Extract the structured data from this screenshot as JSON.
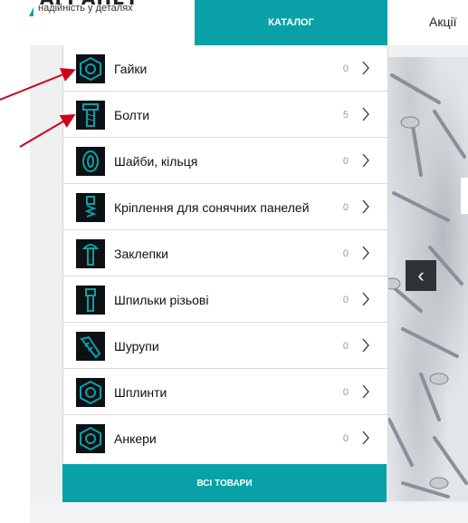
{
  "header": {
    "logo_text": "АГРАНЕТ",
    "tagline": "надійність у деталях",
    "catalog_label": "КАТАЛОГ",
    "promo_label": "Акції"
  },
  "menu": {
    "items": [
      {
        "label": "Гайки",
        "count": "0",
        "icon": "nut-icon"
      },
      {
        "label": "Болти",
        "count": "5",
        "icon": "bolt-icon"
      },
      {
        "label": "Шайби, кільця",
        "count": "0",
        "icon": "washer-icon"
      },
      {
        "label": "Кріплення для сонячних панелей",
        "count": "0",
        "icon": "solar-mount-icon"
      },
      {
        "label": "Заклепки",
        "count": "0",
        "icon": "rivet-icon"
      },
      {
        "label": "Шпильки різьові",
        "count": "0",
        "icon": "threaded-rod-icon"
      },
      {
        "label": "Шурупи",
        "count": "0",
        "icon": "screw-icon"
      },
      {
        "label": "Шплинти",
        "count": "0",
        "icon": "cotter-pin-icon"
      },
      {
        "label": "Анкери",
        "count": "0",
        "icon": "anchor-icon"
      }
    ],
    "all_products_label": "ВСІ ТОВАРИ"
  },
  "slider": {
    "prev_symbol": "‹"
  },
  "colors": {
    "accent": "#0aa0a8",
    "arrow": "#d0021b",
    "icon_bg": "#0d1114"
  }
}
